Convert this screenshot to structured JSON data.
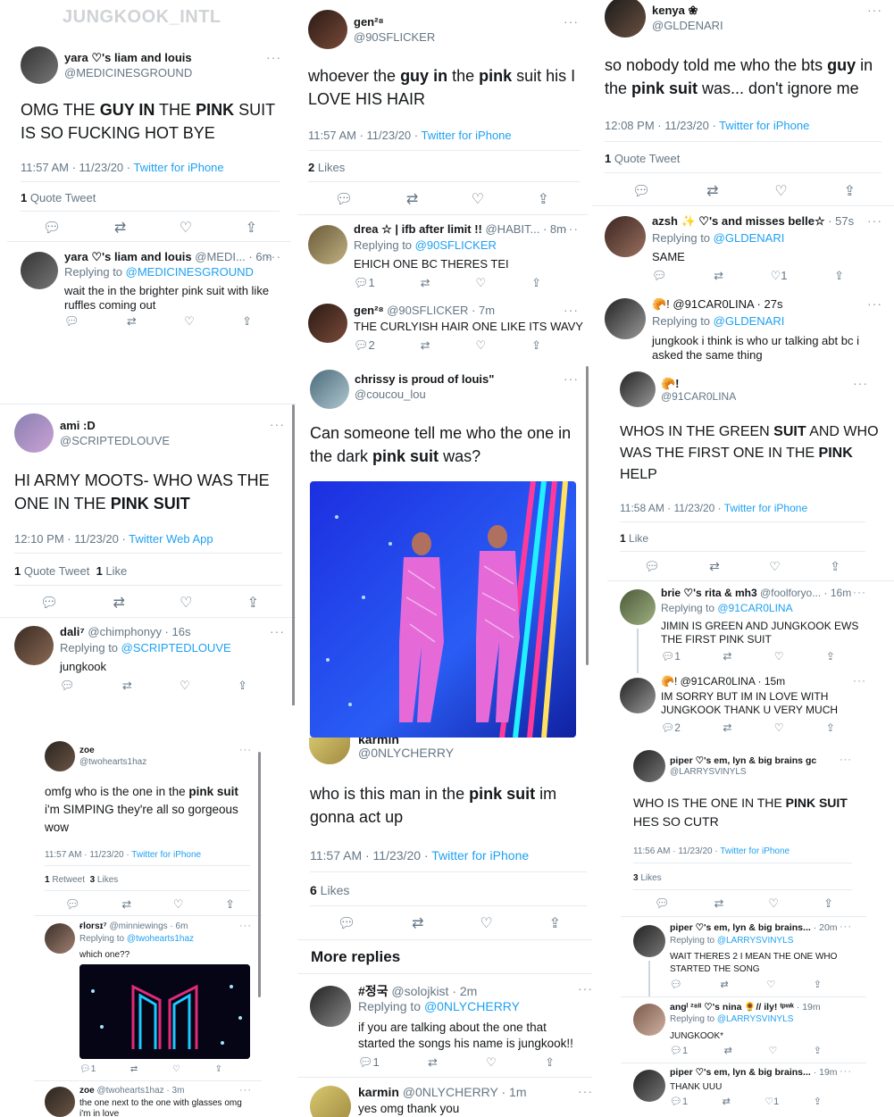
{
  "watermark": "JUNGKOOK_INTL",
  "p1": {
    "name": "yara ♡'s liam and louis",
    "handle": "@MEDICINESGROUND",
    "text_parts": [
      "OMG THE ",
      "GUY IN",
      " THE ",
      "PINK",
      " SUIT IS SO FUCKING HOT BYE"
    ],
    "time": "11:57 AM · 11/23/20 · ",
    "source": "Twitter for iPhone",
    "stat_num": "1",
    "stat_label": " Quote Tweet",
    "reply": {
      "name": "yara ♡'s liam and louis",
      "handle_time": " @MEDI... · 6m",
      "replying": "Replying to ",
      "to": "@MEDICINESGROUND",
      "text": "wait the in the brighter pink suit with like ruffles coming out"
    }
  },
  "p2": {
    "name": "ami :D",
    "handle": "@SCRIPTEDLOUVE",
    "text_parts": [
      "HI ARMY MOOTS- WHO WAS THE ONE IN THE ",
      "PINK SUIT"
    ],
    "time": "12:10 PM · 11/23/20 · ",
    "source": "Twitter Web App",
    "stat1_num": "1",
    "stat1_label": " Quote Tweet",
    "stat2_num": "1",
    "stat2_label": " Like",
    "reply": {
      "name": "dali⁷",
      "handle_time": " @chimphonyy · 16s",
      "replying": "Replying to ",
      "to": "@SCRIPTEDLOUVE",
      "text": "jungkook"
    }
  },
  "p3": {
    "name": "zoe",
    "handle": "@twohearts1haz",
    "text_parts": [
      "omfg who is the one in the ",
      "pink suit",
      " i'm SIMPING they're all so gorgeous wow"
    ],
    "time": "11:57 AM · 11/23/20 · ",
    "source": "Twitter for iPhone",
    "stat1_num": "1",
    "stat1_label": " Retweet",
    "stat2_num": "3",
    "stat2_label": " Likes",
    "reply1": {
      "name": "ғlorsɪ⁷",
      "handle_time": " @minniewings · 6m",
      "replying": "Replying to ",
      "to": "@twohearts1haz",
      "text": "which one??",
      "reply_count": "1"
    },
    "reply2": {
      "name": "zoe",
      "handle_time": " @twohearts1haz · 3m",
      "text": "the one next to the one with glasses omg i'm in love"
    }
  },
  "p4": {
    "name": "gen²⁸",
    "handle": "@90SFLICKER",
    "text_parts": [
      "whoever the ",
      "guy in",
      " the ",
      "pink",
      " suit his I LOVE HIS HAIR"
    ],
    "time": "11:57 AM · 11/23/20 · ",
    "source": "Twitter for iPhone",
    "stat_num": "2",
    "stat_label": " Likes",
    "reply1": {
      "name": "drea ☆ | ifb after limit !!",
      "handle_time": " @HABIT... · 8m",
      "replying": "Replying to ",
      "to": "@90SFLICKER",
      "text": "EHICH ONE BC THERES TEI",
      "reply_count": "1"
    },
    "reply2": {
      "name": "gen²⁸",
      "handle_time": " @90SFLICKER · 7m",
      "text": "THE CURLYISH HAIR ONE LIKE ITS WAVY",
      "reply_count": "2"
    }
  },
  "p5": {
    "name": "chrissy is proud of louis\"",
    "handle": "@coucou_lou",
    "text_parts": [
      "Can someone tell me who the one in the dark ",
      "pink suit",
      " was?"
    ]
  },
  "p6": {
    "name": "karmin",
    "handle": "@0NLYCHERRY",
    "text_parts": [
      "who is this man in the ",
      "pink suit",
      " im gonna act up"
    ],
    "time": "11:57 AM · 11/23/20 · ",
    "source": "Twitter for iPhone",
    "stat_num": "6",
    "stat_label": " Likes",
    "more_replies": "More replies",
    "reply1": {
      "name": "#정국",
      "handle_time": " @solojkist · 2m",
      "replying": "Replying to ",
      "to": "@0NLYCHERRY",
      "text": "if you are talking about the one that started the songs his name is jungkook!!",
      "reply_count": "1"
    },
    "reply2": {
      "name": "karmin",
      "handle_time": " @0NLYCHERRY · 1m",
      "text": "yes omg thank you"
    }
  },
  "p7": {
    "name": "kenya ❀",
    "handle": "@GLDENARI",
    "text_parts": [
      "so nobody told me who the bts ",
      "guy",
      " in the ",
      "pink suit",
      " was...  don't ignore me"
    ],
    "time": "12:08 PM · 11/23/20 · ",
    "source": "Twitter for iPhone",
    "stat_num": "1",
    "stat_label": " Quote Tweet",
    "reply1": {
      "name": "azsh ✨ ♡'s and misses belle☆",
      "handle_time": " · 57s",
      "replying": "Replying to ",
      "to": "@GLDENARI",
      "text": "SAME",
      "like_count": "1"
    },
    "reply2": {
      "name": "🥐! @91CAR0LINA · 27s",
      "replying": "Replying to ",
      "to": "@GLDENARI",
      "text": "jungkook i think is who ur talking abt bc i asked the same thing"
    }
  },
  "p8": {
    "name": "🥐!",
    "handle": "@91CAR0LINA",
    "text_parts": [
      "WHOS IN THE GREEN ",
      "SUIT",
      " AND WHO WAS THE FIRST ONE IN THE ",
      "PINK",
      " HELP"
    ],
    "time": "11:58 AM · 11/23/20 · ",
    "source": "Twitter for iPhone",
    "stat_num": "1",
    "stat_label": " Like",
    "reply1": {
      "name": "brie ♡'s rita & mh3",
      "handle_time": " @foolforyo... · 16m",
      "replying": "Replying to ",
      "to": "@91CAR0LINA",
      "text": "JIMIN IS GREEN AND JUNGKOOK EWS THE FIRST PINK SUIT",
      "reply_count": "1"
    },
    "reply2": {
      "name": "🥐! @91CAR0LINA · 15m",
      "text": "IM SORRY BUT IM IN LOVE WITH JUNGKOOK THANK U VERY MUCH",
      "reply_count": "2"
    }
  },
  "p9": {
    "name": "piper ♡'s em, lyn & big brains gc",
    "handle": "@LARRYSVINYLS",
    "text_parts": [
      "WHO IS THE ONE IN THE ",
      "PINK SUIT",
      " HES SO CUTR"
    ],
    "time": "11:56 AM · 11/23/20 · ",
    "source": "Twitter for iPhone",
    "stat_num": "3",
    "stat_label": " Likes",
    "reply1": {
      "name": "piper ♡'s em, lyn & big brains...",
      "handle_time": " · 20m",
      "replying": "Replying to ",
      "to": "@LARRYSVINYLS",
      "text": "WAIT THERES 2 I MEAN THE ONE WHO STARTED THE SONG"
    },
    "reply2": {
      "name": "angˡ ²⁸ᴵᴵ ♡'s nina 🌻// ily! ᵗᵖʷᵏ",
      "handle_time": " · 19m",
      "replying": "Replying to ",
      "to": "@LARRYSVINYLS",
      "text": "JUNGKOOK*",
      "reply_count": "1"
    },
    "reply3": {
      "name": "piper ♡'s em, lyn & big brains...",
      "handle_time": " · 19m",
      "text": "THANK UUU",
      "reply_count": "1",
      "like_count": "1"
    }
  },
  "icons": [
    "reply-icon",
    "retweet-icon",
    "like-icon",
    "share-icon",
    "more-icon"
  ]
}
